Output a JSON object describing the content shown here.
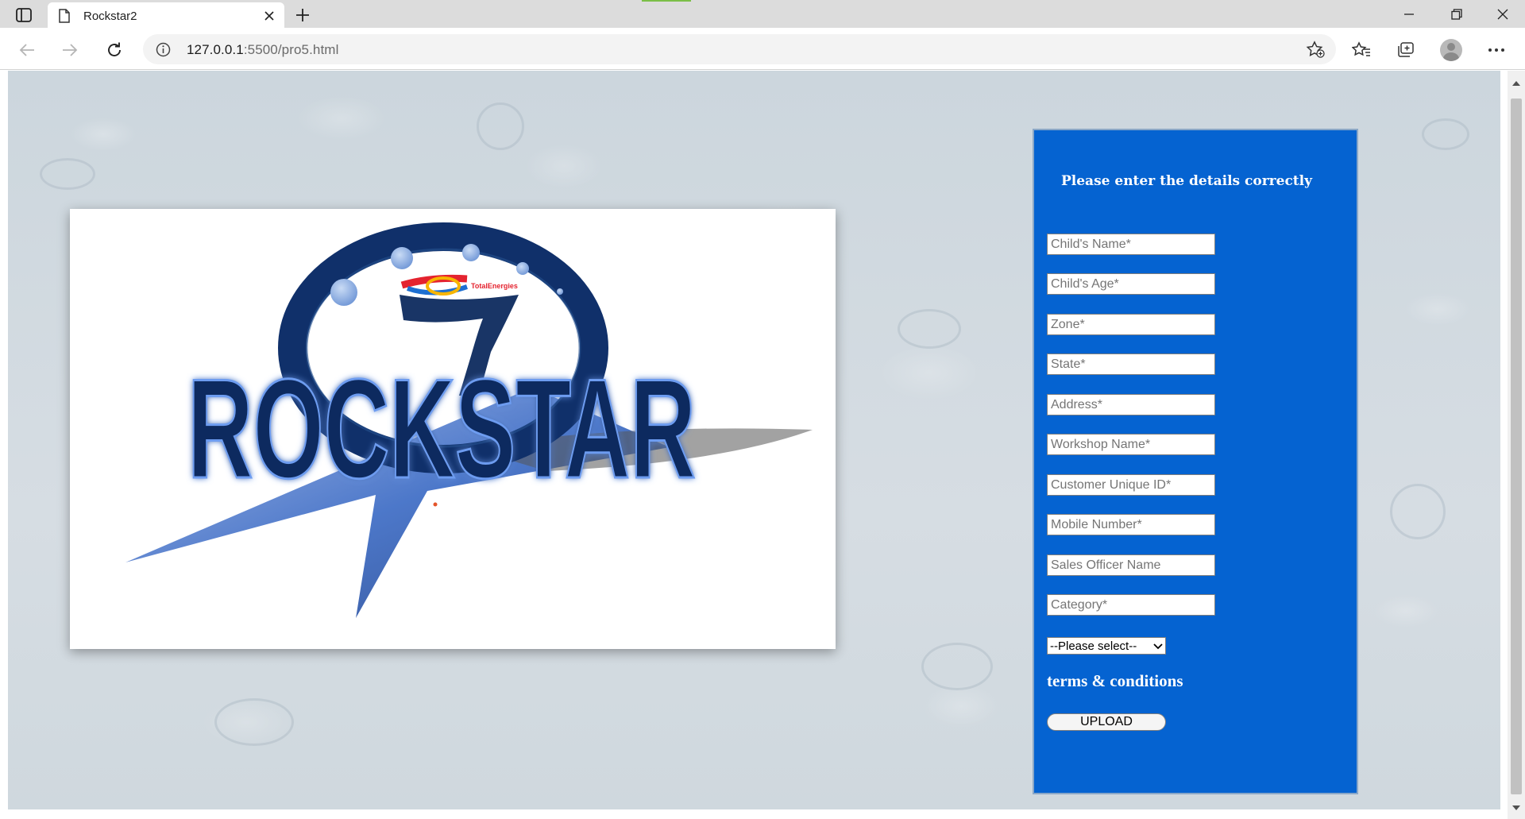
{
  "browser": {
    "tab": {
      "title": "Rockstar2"
    },
    "url_host": "127.0.0.1",
    "url_path": ":5500/pro5.html"
  },
  "logo": {
    "wordmark": "ROCKSTAR",
    "sponsor": "TotalEnergies"
  },
  "form": {
    "heading": "Please enter the details correctly",
    "fields": [
      {
        "placeholder": "Child's Name*"
      },
      {
        "placeholder": "Child's Age*"
      },
      {
        "placeholder": "Zone*"
      },
      {
        "placeholder": "State*"
      },
      {
        "placeholder": "Address*"
      },
      {
        "placeholder": "Workshop Name*"
      },
      {
        "placeholder": "Customer Unique ID*"
      },
      {
        "placeholder": "Mobile Number*"
      },
      {
        "placeholder": "Sales Officer Name"
      },
      {
        "placeholder": "Category*"
      }
    ],
    "select_value": "--Please select--",
    "terms_label": "terms & conditions",
    "upload_label": "UPLOAD"
  },
  "colors": {
    "panel_bg": "#0563d1",
    "logo_navy": "#0d2a5e",
    "logo_blue": "#3a6fc9"
  }
}
